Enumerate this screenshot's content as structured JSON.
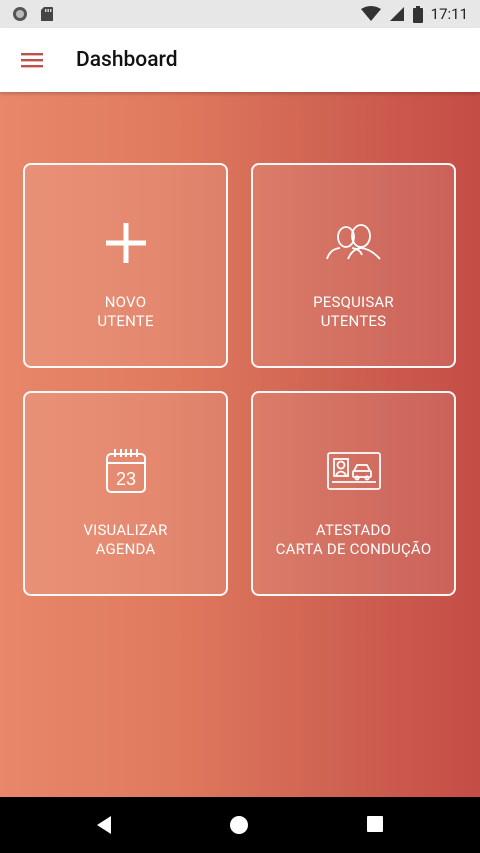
{
  "status_bar": {
    "time": "17:11",
    "icons": [
      "circle-notification-icon",
      "sd-card-icon",
      "wifi-icon",
      "signal-icon",
      "battery-icon"
    ]
  },
  "app_bar": {
    "title": "Dashboard",
    "menu_icon": "hamburger-menu-icon"
  },
  "dashboard": {
    "cards": [
      {
        "icon": "plus-icon",
        "line1": "NOVO",
        "line2": "UTENTE"
      },
      {
        "icon": "people-icon",
        "line1": "PESQUISAR",
        "line2": "UTENTES"
      },
      {
        "icon": "calendar-icon",
        "calendar_day": "23",
        "line1": "VISUALIZAR",
        "line2": "AGENDA"
      },
      {
        "icon": "id-card-icon",
        "line1": "ATESTADO",
        "line2": "CARTA DE CONDUÇÃO"
      }
    ]
  },
  "nav_bar": {
    "icons": [
      "back-icon",
      "home-icon",
      "recents-icon"
    ]
  },
  "colors": {
    "accent": "#c0504a",
    "gradient_start": "#e8876a",
    "gradient_end": "#c44d45"
  }
}
